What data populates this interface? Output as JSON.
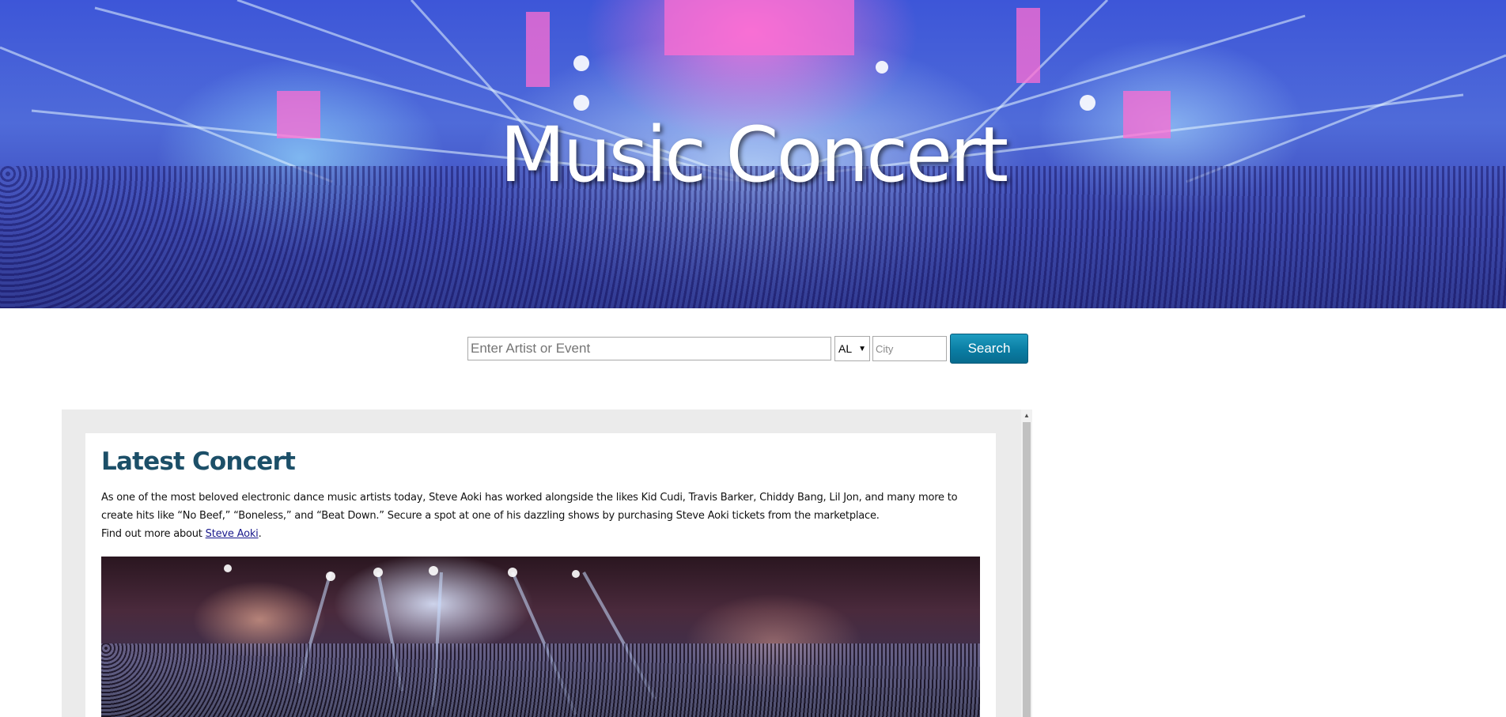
{
  "hero": {
    "title": "Music Concert"
  },
  "search": {
    "artist_placeholder": "Enter Artist or Event",
    "state_value": "AL",
    "city_placeholder": "City",
    "button_label": "Search"
  },
  "latest": {
    "title": "Latest Concert",
    "description": "As one of the most beloved electronic dance music artists today, Steve Aoki has worked alongside the likes Kid Cudi, Travis Barker, Chiddy Bang, Lil Jon, and many more to create hits like “No Beef,” “Boneless,” and “Beat Down.” Secure a spot at one of his dazzling shows by purchasing Steve Aoki tickets from the marketplace.",
    "find_more_prefix": "Find out more about ",
    "link_text": "Steve Aoki",
    "find_more_suffix": "."
  },
  "colors": {
    "title": "#1c4f68",
    "button": "#0a7da3",
    "link": "#1a1a8c"
  }
}
